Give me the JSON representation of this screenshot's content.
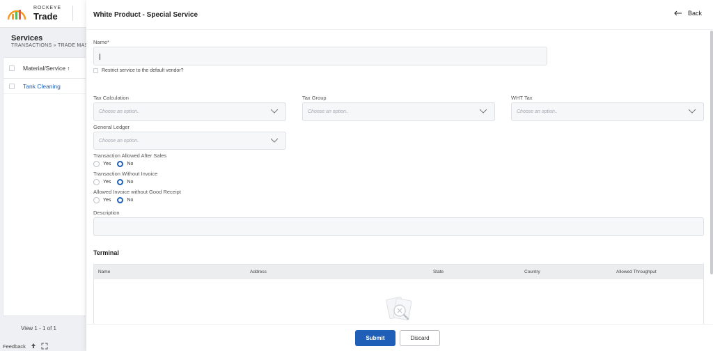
{
  "app": {
    "brand_top": "ROCKEYE",
    "brand_bottom": "Trade"
  },
  "background": {
    "title": "Services",
    "breadcrumb": "TRANSACTIONS » TRADE MAST",
    "grid": {
      "header": "Material/Service ↑",
      "rows": [
        "Tank Cleaning"
      ]
    },
    "view_count": "View 1 - 1 of 1",
    "feedback": "Feedback"
  },
  "drawer": {
    "title": "White Product - Special Service",
    "back": "Back",
    "name_label": "Name*",
    "name_value": "",
    "restrict_label": "Restrict service to the default vendor?",
    "tax_calc_label": "Tax Calculation",
    "tax_group_label": "Tax Group",
    "wht_label": "WHT Tax",
    "gl_label": "General Ledger",
    "select_placeholder": "Choose an option..",
    "radio_groups": [
      {
        "label": "Transaction Allowed After Sales",
        "yes": "Yes",
        "no": "No",
        "selected": "No"
      },
      {
        "label": "Transaction Without Invoice",
        "yes": "Yes",
        "no": "No",
        "selected": "No"
      },
      {
        "label": "Allowed Invoice without Good Receipt",
        "yes": "Yes",
        "no": "No",
        "selected": "No"
      }
    ],
    "description_label": "Description",
    "terminal": {
      "title": "Terminal",
      "columns": [
        "Name",
        "Address",
        "State",
        "Country",
        "Allowed Throughput"
      ]
    },
    "submit": "Submit",
    "discard": "Discard"
  },
  "colors": {
    "accent": "#1f5fb8",
    "logo_orange": "#f39a1f",
    "logo_green": "#5cb85c"
  }
}
